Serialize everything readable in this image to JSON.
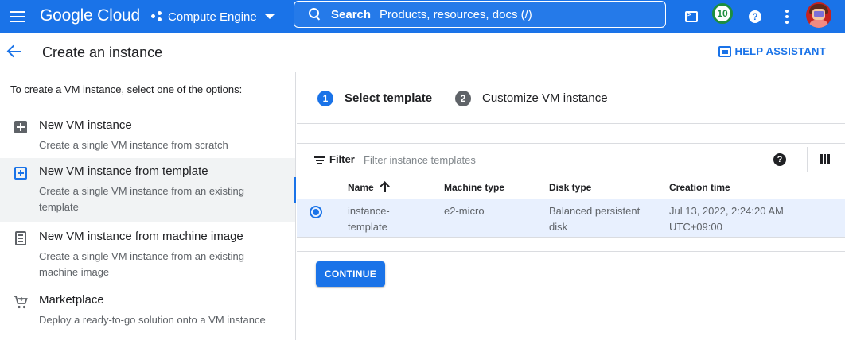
{
  "topbar": {
    "logo": "Google Cloud",
    "product": "Compute Engine",
    "search_label": "Search",
    "search_placeholder": "Products, resources, docs (/)",
    "notification_count": "10",
    "help_glyph": "?"
  },
  "header": {
    "title": "Create an instance",
    "help_assistant": "HELP ASSISTANT"
  },
  "left": {
    "intro": "To create a VM instance, select one of the options:",
    "options": [
      {
        "title": "New VM instance",
        "desc": "Create a single VM instance from scratch",
        "icon": "add-box-icon",
        "selected": false
      },
      {
        "title": "New VM instance from template",
        "desc": "Create a single VM instance from an existing template",
        "icon": "template-icon",
        "selected": true
      },
      {
        "title": "New VM instance from machine image",
        "desc": "Create a single VM instance from an existing machine image",
        "icon": "machine-image-icon",
        "selected": false
      },
      {
        "title": "Marketplace",
        "desc": "Deploy a ready-to-go solution onto a VM instance",
        "icon": "cart-icon",
        "selected": false
      }
    ]
  },
  "stepper": {
    "step1_num": "1",
    "step1_label": "Select template",
    "step2_num": "2",
    "step2_label": "Customize VM instance"
  },
  "filter": {
    "label": "Filter",
    "placeholder": "Filter instance templates",
    "help_glyph": "?"
  },
  "table": {
    "headers": [
      "Name",
      "Machine type",
      "Disk type",
      "Creation time"
    ],
    "rows": [
      {
        "name": "instance-template",
        "machine_type": "e2-micro",
        "disk_type": "Balanced persistent disk",
        "creation_time": "Jul 13, 2022, 2:24:20 AM UTC+09:00",
        "selected": true
      }
    ]
  },
  "actions": {
    "continue": "CONTINUE"
  },
  "colors": {
    "brand": "#1a73e8",
    "selected_row": "#e8f0fe",
    "badge": "#1e8e3e"
  }
}
